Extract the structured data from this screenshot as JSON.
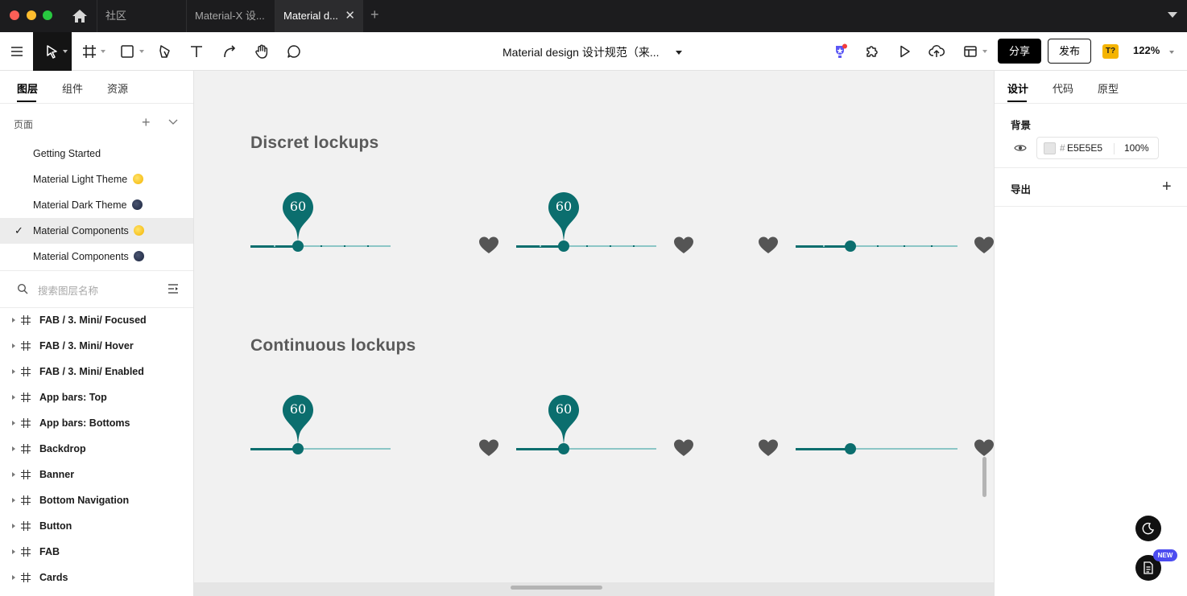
{
  "window": {
    "tabs": [
      {
        "label": "社区",
        "active": false
      },
      {
        "label": "Material-X 设...",
        "active": false
      },
      {
        "label": "Material d...",
        "active": true
      }
    ],
    "close_glyph": "✕",
    "new_tab_glyph": "+"
  },
  "toolbar": {
    "document_title": "Material design 设计规范（来...",
    "share_label": "分享",
    "publish_label": "发布",
    "avatar_text": "T?",
    "zoom": "122%",
    "icons": [
      "menu-icon",
      "move-icon",
      "frame-icon",
      "rectangle-icon",
      "pen-icon",
      "text-icon",
      "connector-icon",
      "hand-icon",
      "comment-icon",
      "trophy-icon",
      "plugin-icon",
      "play-icon",
      "upload-icon",
      "layout-icon"
    ]
  },
  "left_panel": {
    "tabs": [
      {
        "label": "图层",
        "active": true
      },
      {
        "label": "组件",
        "active": false
      },
      {
        "label": "资源",
        "active": false
      }
    ],
    "pages_label": "页面",
    "pages": [
      {
        "label": "Getting Started",
        "dot": "",
        "selected": false
      },
      {
        "label": "Material Light Theme",
        "dot": "sun",
        "selected": false
      },
      {
        "label": "Material Dark Theme",
        "dot": "moon",
        "selected": false
      },
      {
        "label": "Material Components",
        "dot": "sun",
        "selected": true
      },
      {
        "label": "Material Components",
        "dot": "moon",
        "selected": false
      }
    ],
    "check_glyph": "✓",
    "search_placeholder": "搜索图层名称",
    "layers": [
      "FAB / 3. Mini/ Focused",
      "FAB / 3. Mini/ Hover",
      "FAB / 3. Mini/ Enabled",
      "App bars: Top",
      "App bars: Bottoms",
      "Backdrop",
      "Banner",
      "Bottom Navigation",
      "Button",
      "FAB",
      "Cards"
    ]
  },
  "canvas": {
    "sections": [
      {
        "title": "Discret lockups",
        "discrete": true
      },
      {
        "title": "Continuous lockups",
        "discrete": false
      }
    ],
    "slider_value": "60",
    "slider_fraction": 0.34,
    "third_slider_fraction": 0.34,
    "colors": {
      "accent": "#0b6e6e",
      "track": "#8cc6c6",
      "heart": "#555555",
      "background": "#f1f1f1"
    }
  },
  "right_panel": {
    "tabs": [
      {
        "label": "设计",
        "active": true
      },
      {
        "label": "代码",
        "active": false
      },
      {
        "label": "原型",
        "active": false
      }
    ],
    "background_label": "背景",
    "background_hash": "#",
    "background_hex": "E5E5E5",
    "background_opacity": "100%",
    "export_label": "导出",
    "new_badge": "NEW"
  }
}
